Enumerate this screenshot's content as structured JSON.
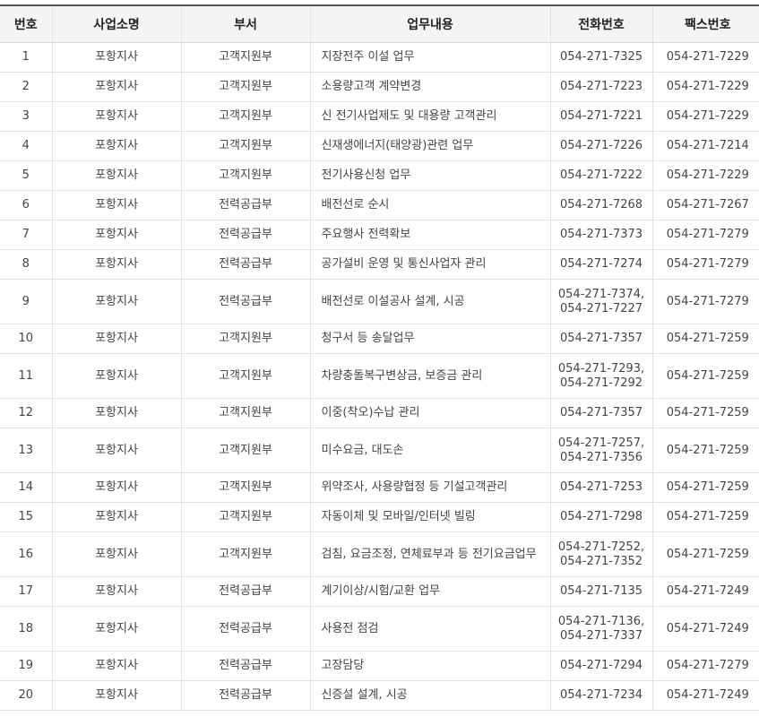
{
  "table": {
    "headers": {
      "no": "번호",
      "biz": "사업소명",
      "dept": "부서",
      "task": "업무내용",
      "tel": "전화번호",
      "fax": "팩스번호"
    },
    "rows": [
      {
        "no": "1",
        "biz": "포항지사",
        "dept": "고객지원부",
        "task": "지장전주 이설 업무",
        "tel": "054-271-7325",
        "fax": "054-271-7229"
      },
      {
        "no": "2",
        "biz": "포항지사",
        "dept": "고객지원부",
        "task": "소용량고객 계약변경",
        "tel": "054-271-7223",
        "fax": "054-271-7229"
      },
      {
        "no": "3",
        "biz": "포항지사",
        "dept": "고객지원부",
        "task": "신 전기사업제도 및 대용량 고객관리",
        "tel": "054-271-7221",
        "fax": "054-271-7229"
      },
      {
        "no": "4",
        "biz": "포항지사",
        "dept": "고객지원부",
        "task": "신재생에너지(태양광)관련 업무",
        "tel": "054-271-7226",
        "fax": "054-271-7214"
      },
      {
        "no": "5",
        "biz": "포항지사",
        "dept": "고객지원부",
        "task": "전기사용신청 업무",
        "tel": "054-271-7222",
        "fax": "054-271-7229"
      },
      {
        "no": "6",
        "biz": "포항지사",
        "dept": "전력공급부",
        "task": "배전선로 순시",
        "tel": "054-271-7268",
        "fax": "054-271-7267"
      },
      {
        "no": "7",
        "biz": "포항지사",
        "dept": "전력공급부",
        "task": "주요행사 전력확보",
        "tel": "054-271-7373",
        "fax": "054-271-7279"
      },
      {
        "no": "8",
        "biz": "포항지사",
        "dept": "전력공급부",
        "task": "공가설비 운영 및 통신사업자 관리",
        "tel": "054-271-7274",
        "fax": "054-271-7279"
      },
      {
        "no": "9",
        "biz": "포항지사",
        "dept": "전력공급부",
        "task": "배전선로 이설공사 설계, 시공",
        "tel": "054-271-7374,\n054-271-7227",
        "fax": "054-271-7279"
      },
      {
        "no": "10",
        "biz": "포항지사",
        "dept": "고객지원부",
        "task": "청구서 등 송달업무",
        "tel": "054-271-7357",
        "fax": "054-271-7259"
      },
      {
        "no": "11",
        "biz": "포항지사",
        "dept": "고객지원부",
        "task": "차량충돌복구변상금, 보증금 관리",
        "tel": "054-271-7293,\n054-271-7292",
        "fax": "054-271-7259"
      },
      {
        "no": "12",
        "biz": "포항지사",
        "dept": "고객지원부",
        "task": "이중(착오)수납 관리",
        "tel": "054-271-7357",
        "fax": "054-271-7259"
      },
      {
        "no": "13",
        "biz": "포항지사",
        "dept": "고객지원부",
        "task": "미수요금, 대도손",
        "tel": "054-271-7257,\n054-271-7356",
        "fax": "054-271-7259"
      },
      {
        "no": "14",
        "biz": "포항지사",
        "dept": "고객지원부",
        "task": "위약조사, 사용량협정 등 기설고객관리",
        "tel": "054-271-7253",
        "fax": "054-271-7259"
      },
      {
        "no": "15",
        "biz": "포항지사",
        "dept": "고객지원부",
        "task": "자동이체 및 모바일/인터넷 빌링",
        "tel": "054-271-7298",
        "fax": "054-271-7259"
      },
      {
        "no": "16",
        "biz": "포항지사",
        "dept": "고객지원부",
        "task": "검침, 요금조정, 연체료부과 등 전기요금업무",
        "tel": "054-271-7252,\n054-271-7352",
        "fax": "054-271-7259"
      },
      {
        "no": "17",
        "biz": "포항지사",
        "dept": "전력공급부",
        "task": "계기이상/시험/교환 업무",
        "tel": "054-271-7135",
        "fax": "054-271-7249"
      },
      {
        "no": "18",
        "biz": "포항지사",
        "dept": "전력공급부",
        "task": "사용전 점검",
        "tel": "054-271-7136,\n054-271-7337",
        "fax": "054-271-7249"
      },
      {
        "no": "19",
        "biz": "포항지사",
        "dept": "전력공급부",
        "task": "고장담당",
        "tel": "054-271-7294",
        "fax": "054-271-7279"
      },
      {
        "no": "20",
        "biz": "포항지사",
        "dept": "전력공급부",
        "task": "신증설 설계, 시공",
        "tel": "054-271-7234",
        "fax": "054-271-7249"
      }
    ]
  }
}
